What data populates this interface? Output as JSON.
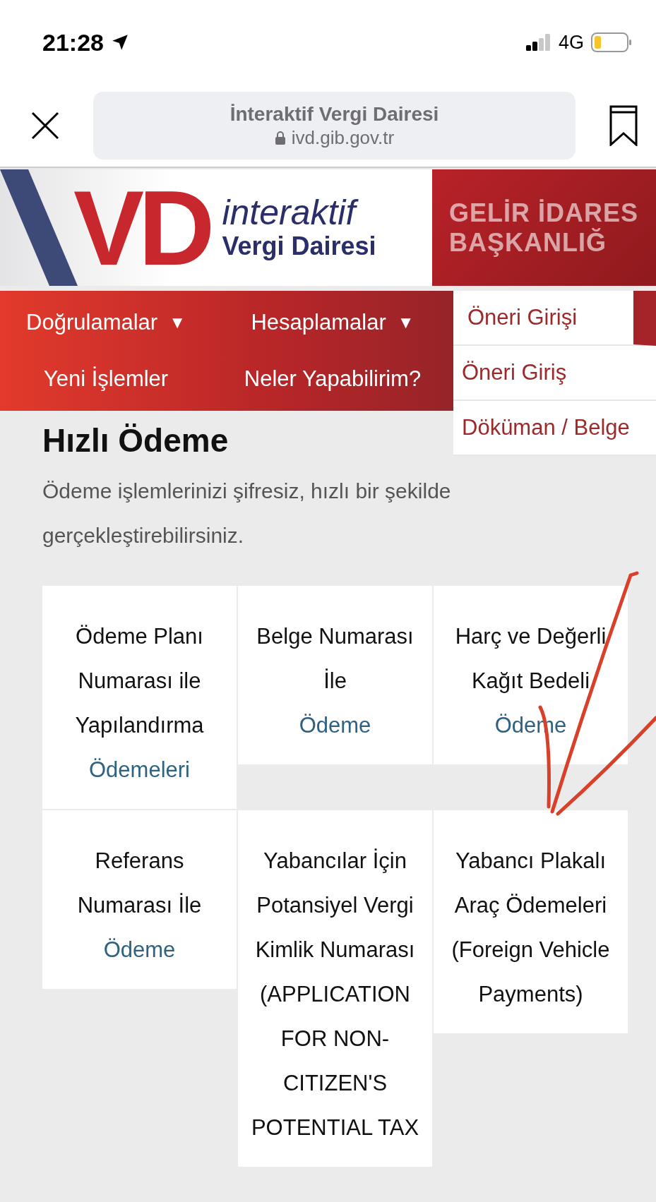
{
  "status_bar": {
    "time": "21:28",
    "network": "4G"
  },
  "browser_bar": {
    "title": "İnteraktif Vergi Dairesi",
    "url": "ivd.gib.gov.tr"
  },
  "banner": {
    "logo_mark": "VD",
    "logo_line1": "interaktif",
    "logo_line2": "Vergi Dairesi",
    "side_line1": "GELİR İDARES",
    "side_line2": "BAŞKANLIĞ"
  },
  "nav": {
    "items": [
      {
        "label": "Doğrulamalar",
        "caret": "▼"
      },
      {
        "label": "Hesaplamalar",
        "caret": "▼"
      },
      {
        "label": "Yeni İşlemler"
      },
      {
        "label": "Neler Yapabilirim?"
      }
    ],
    "dropdown": [
      {
        "label": "Öneri Girişi",
        "selected": true
      },
      {
        "label": "Öneri Giriş",
        "selected": false
      },
      {
        "label": "Döküman / Belge",
        "selected": false
      }
    ]
  },
  "page": {
    "title": "Hızlı Ödeme",
    "description": "Ödeme işlemlerinizi şifresiz, hızlı bir şekilde gerçekleştirebilirsiniz."
  },
  "cards": [
    {
      "title": "Ödeme Planı Numarası ile Yapılandırma",
      "link": "Ödemeleri"
    },
    {
      "title": "Belge Numarası İle",
      "link": "Ödeme"
    },
    {
      "title": "Harç ve Değerli Kağıt Bedeli",
      "link": "Ödeme"
    },
    {
      "title": "Referans Numarası İle",
      "link": "Ödeme"
    },
    {
      "title": "Yabancılar İçin Potansiyel Vergi Kimlik Numarası (APPLICATION FOR NON-CITIZEN'S POTENTIAL TAX"
    },
    {
      "title": "Yabancı Plakalı Araç Ödemeleri (Foreign Vehicle Payments)"
    }
  ],
  "annotation": {
    "kind": "checkmark",
    "color": "#d8402a"
  }
}
